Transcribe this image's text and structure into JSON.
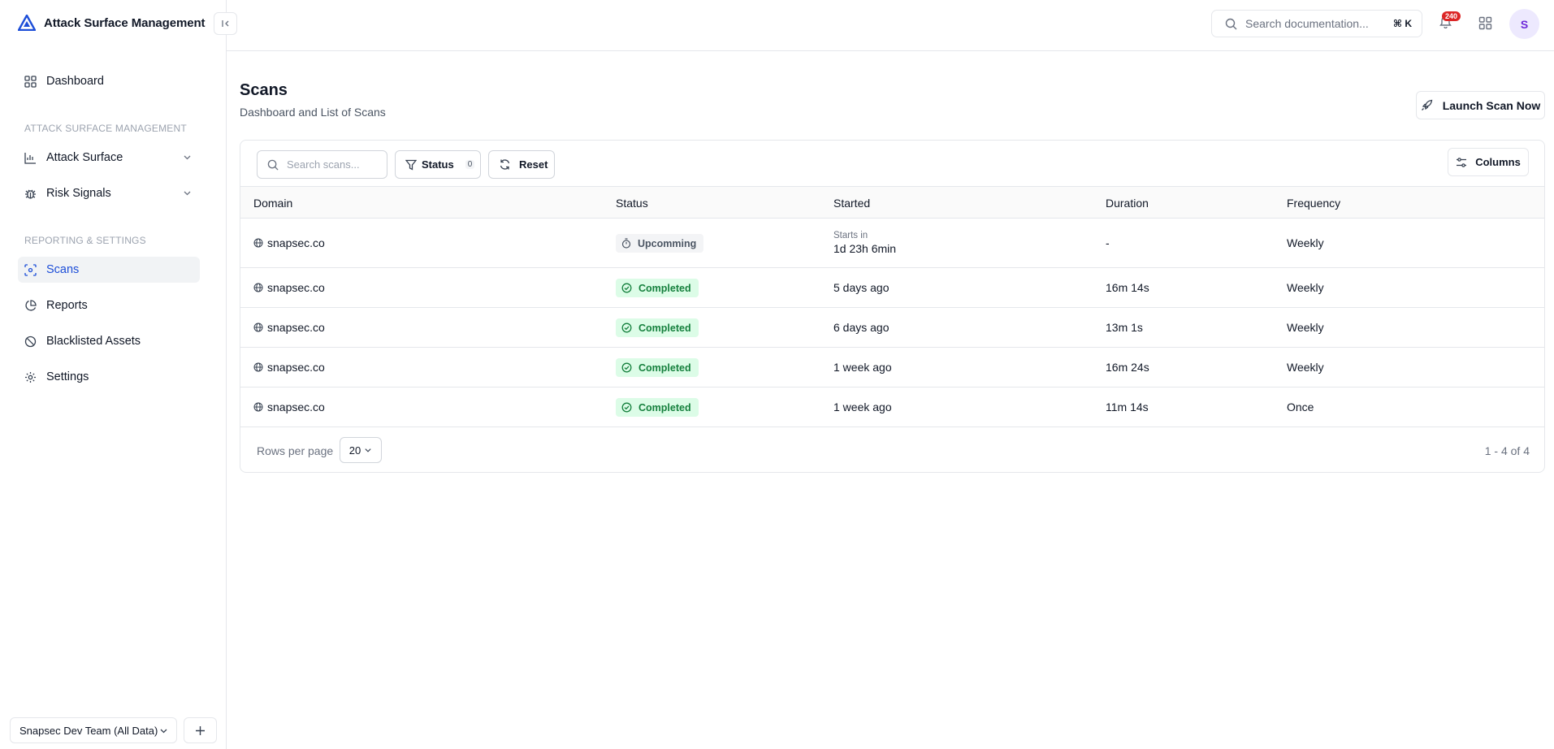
{
  "brand": {
    "name": "Attack Surface Management",
    "accent": "#1d4ed8"
  },
  "sidebar": {
    "dashboard_label": "Dashboard",
    "section1_label": "ATTACK SURFACE MANAGEMENT",
    "attack_surface_label": "Attack Surface",
    "risk_signals_label": "Risk Signals",
    "section2_label": "REPORTING & SETTINGS",
    "scans_label": "Scans",
    "reports_label": "Reports",
    "blacklisted_label": "Blacklisted Assets",
    "settings_label": "Settings",
    "team_label": "Snapsec Dev Team (All Data)"
  },
  "topbar": {
    "search_placeholder": "Search documentation...",
    "search_shortcut": "⌘ K",
    "notification_count": "240",
    "avatar_initial": "S"
  },
  "page": {
    "title": "Scans",
    "subtitle": "Dashboard and List of Scans",
    "launch_label": "Launch Scan Now"
  },
  "toolbar": {
    "search_placeholder": "Search scans...",
    "status_label": "Status",
    "status_count": "0",
    "reset_label": "Reset",
    "columns_label": "Columns"
  },
  "table": {
    "headers": {
      "domain": "Domain",
      "status": "Status",
      "started": "Started",
      "duration": "Duration",
      "frequency": "Frequency"
    },
    "rows": [
      {
        "domain": "snapsec.co",
        "status": "Upcomming",
        "status_kind": "upcoming",
        "started_prefix": "Starts in",
        "started": "1d 23h 6min",
        "duration": "-",
        "frequency": "Weekly"
      },
      {
        "domain": "snapsec.co",
        "status": "Completed",
        "status_kind": "completed",
        "started_prefix": "",
        "started": "5 days ago",
        "duration": "16m 14s",
        "frequency": "Weekly"
      },
      {
        "domain": "snapsec.co",
        "status": "Completed",
        "status_kind": "completed",
        "started_prefix": "",
        "started": "6 days ago",
        "duration": "13m 1s",
        "frequency": "Weekly"
      },
      {
        "domain": "snapsec.co",
        "status": "Completed",
        "status_kind": "completed",
        "started_prefix": "",
        "started": "1 week ago",
        "duration": "16m 24s",
        "frequency": "Weekly"
      },
      {
        "domain": "snapsec.co",
        "status": "Completed",
        "status_kind": "completed",
        "started_prefix": "",
        "started": "1 week ago",
        "duration": "11m 14s",
        "frequency": "Once"
      }
    ]
  },
  "pagination": {
    "rows_per_page_label": "Rows per page",
    "rows_per_page_value": "20",
    "range_text": "1 - 4 of 4"
  }
}
